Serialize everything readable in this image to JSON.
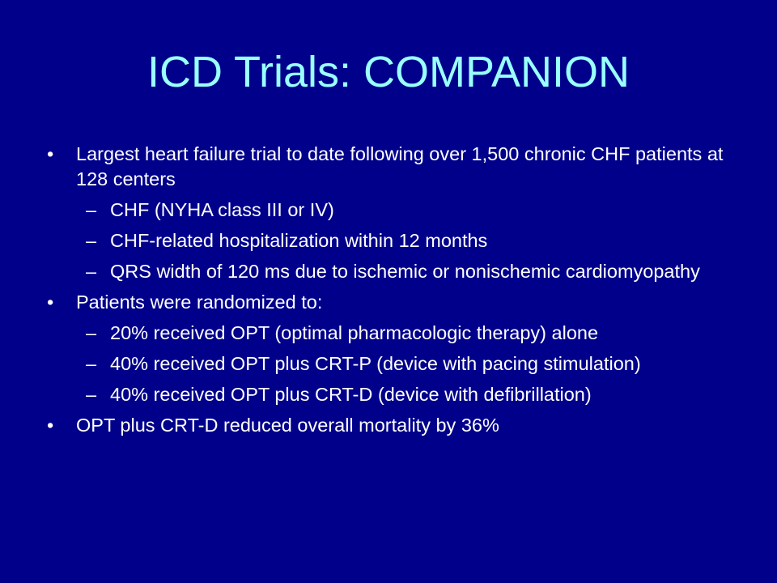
{
  "slide": {
    "title": "ICD Trials:  COMPANION",
    "bullets": [
      {
        "marker": "•",
        "text": "Largest heart failure trial to date following over 1,500 chronic CHF patients at 128 centers",
        "subitems": [
          {
            "marker": "–",
            "text": "CHF (NYHA class III or IV)"
          },
          {
            "marker": "–",
            "text": "CHF-related hospitalization within 12 months"
          },
          {
            "marker": "–",
            "text": "QRS width of 120 ms due to ischemic or nonischemic cardiomyopathy"
          }
        ]
      },
      {
        "marker": "•",
        "text": "Patients were randomized to:",
        "subitems": [
          {
            "marker": "–",
            "text": "20% received OPT (optimal pharmacologic therapy) alone"
          },
          {
            "marker": "–",
            "text": "40% received OPT plus CRT-P (device with pacing stimulation)"
          },
          {
            "marker": "–",
            "text": "40% received OPT plus CRT-D (device with defibrillation)"
          }
        ]
      },
      {
        "marker": "•",
        "text": "OPT plus CRT-D reduced overall mortality by 36%",
        "subitems": []
      }
    ]
  },
  "colors": {
    "background": "#00008b",
    "title": "#99ffff",
    "body_text": "#ffffff"
  }
}
